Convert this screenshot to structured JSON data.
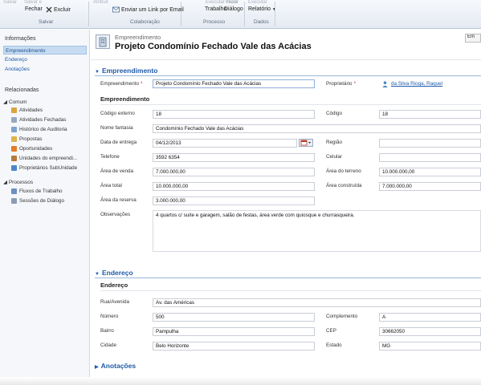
{
  "ribbon": {
    "ghost": [
      "Salvar",
      "Salvar e",
      "Atribuir",
      "Executar Fluxo",
      "Iniciar",
      "Executar"
    ],
    "close_label": "Fechar",
    "delete_label": "Excluir",
    "group_save": "Salvar",
    "email_link_label": "Enviar um Link por Email",
    "group_collab": "Colaboração",
    "workflow_label": "Trabalho",
    "dialog_label": "Diálogo",
    "report_label": "Relatório",
    "group_process": "Processo",
    "group_data": "Dados"
  },
  "leftnav": {
    "info_heading": "Informações",
    "info_items": [
      "Empreendimento",
      "Endereço",
      "Anotações"
    ],
    "related_heading": "Relacionadas",
    "common_group": "Comum",
    "common_items": [
      "Atividades",
      "Atividades Fechadas",
      "Histórico de Auditoria",
      "Propostas",
      "Oportunidades",
      "Unidades do empreendi...",
      "Proprietários SubUnidade"
    ],
    "process_group": "Processos",
    "process_items": [
      "Fluxos de Trabalho",
      "Sessões de Diálogo"
    ]
  },
  "header": {
    "entity_type": "Empreendimento",
    "record_title": "Projeto Condomínio Fechado Vale das Acácias",
    "right_button": "Em"
  },
  "form": {
    "sec1_title": "Empreendimento",
    "name_label": "Empreendimento",
    "name_value": "Projeto Condomínio Fechado Vale das Acácias",
    "owner_label": "Proprietário",
    "owner_value": "da Silva Rioga, Raquel",
    "sub1_title": "Empreendimento",
    "ext_code_label": "Código externo",
    "ext_code_value": "18",
    "code_label": "Código",
    "code_value": "18",
    "fantasy_label": "Nome fantasia",
    "fantasy_value": "Condomínio Fechado Vale das Acácias",
    "delivery_label": "Data de entrega",
    "delivery_value": "04/12/2013",
    "region_label": "Região",
    "region_value": "",
    "phone_label": "Telefone",
    "phone_value": "3592 6354",
    "mobile_label": "Celular",
    "mobile_value": "",
    "sale_area_label": "Área de venda",
    "sale_area_value": "7.000.000,00",
    "land_area_label": "Área do terreno",
    "land_area_value": "10.000.000,00",
    "total_area_label": "Área total",
    "total_area_value": "10.000.000,00",
    "built_area_label": "Área construída",
    "built_area_value": "7.000.000,00",
    "reserve_area_label": "Área da reserva",
    "reserve_area_value": "3.000.000,00",
    "notes_label": "Observações",
    "notes_value": "4 quartos c/ suite e garagem, salão de festas, área verde com quiosque e churrasqueira.",
    "sec2_title": "Endereço",
    "sub2_title": "Endereço",
    "street_label": "Rua/Avenida",
    "street_value": "Av. das Américas",
    "number_label": "Número",
    "number_value": "500",
    "complement_label": "Complemento",
    "complement_value": "A",
    "district_label": "Bairro",
    "district_value": "Pampulha",
    "zip_label": "CEP",
    "zip_value": "30662050",
    "city_label": "Cidade",
    "city_value": "Belo Horizonte",
    "state_label": "Estado",
    "state_value": "MG",
    "sec3_title": "Anotações"
  },
  "icons": {
    "delete": "x-icon",
    "email": "envelope-icon",
    "calendar": "calendar-icon",
    "owner": "user-icon"
  },
  "colors": {
    "accent": "#1e5aa8",
    "required": "#d32020",
    "nav_selected": "#c7dcf2"
  }
}
